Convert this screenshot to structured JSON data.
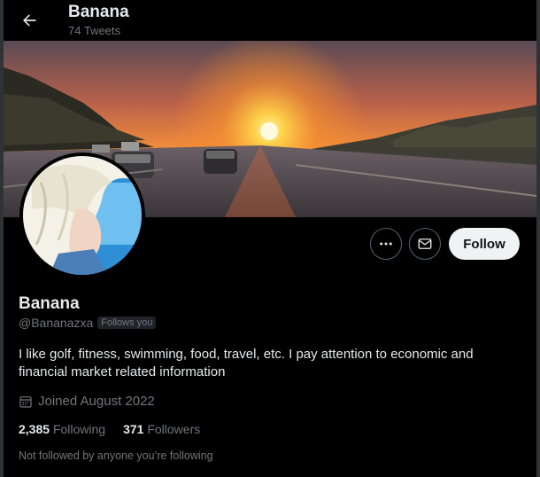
{
  "header": {
    "title": "Banana",
    "tweet_count": "74 Tweets",
    "back_icon": "arrow-left-icon"
  },
  "banner": {
    "description_icon": "sunset-highway-banner",
    "sky_top": "#5a4a55",
    "sun": "#ffd24a"
  },
  "avatar": {
    "icon": "anime-avatar"
  },
  "actions": {
    "more_icon": "more-dots-icon",
    "message_icon": "envelope-icon",
    "follow_label": "Follow"
  },
  "profile": {
    "display_name": "Banana",
    "handle": "@Bananazxa",
    "follows_you": "Follows you",
    "bio": "I like golf, fitness, swimming, food, travel, etc. I pay attention to economic and financial market related information",
    "joined": "Joined August 2022",
    "joined_icon": "calendar-icon"
  },
  "stats": {
    "following_count": "2,385",
    "following_label": "Following",
    "followers_count": "371",
    "followers_label": "Followers"
  },
  "mutuals_text": "Not followed by anyone you’re following",
  "colors": {
    "background": "#000000",
    "text_primary": "#e7e9ea",
    "text_secondary": "#71767b",
    "follow_button_bg": "#eff3f4"
  }
}
